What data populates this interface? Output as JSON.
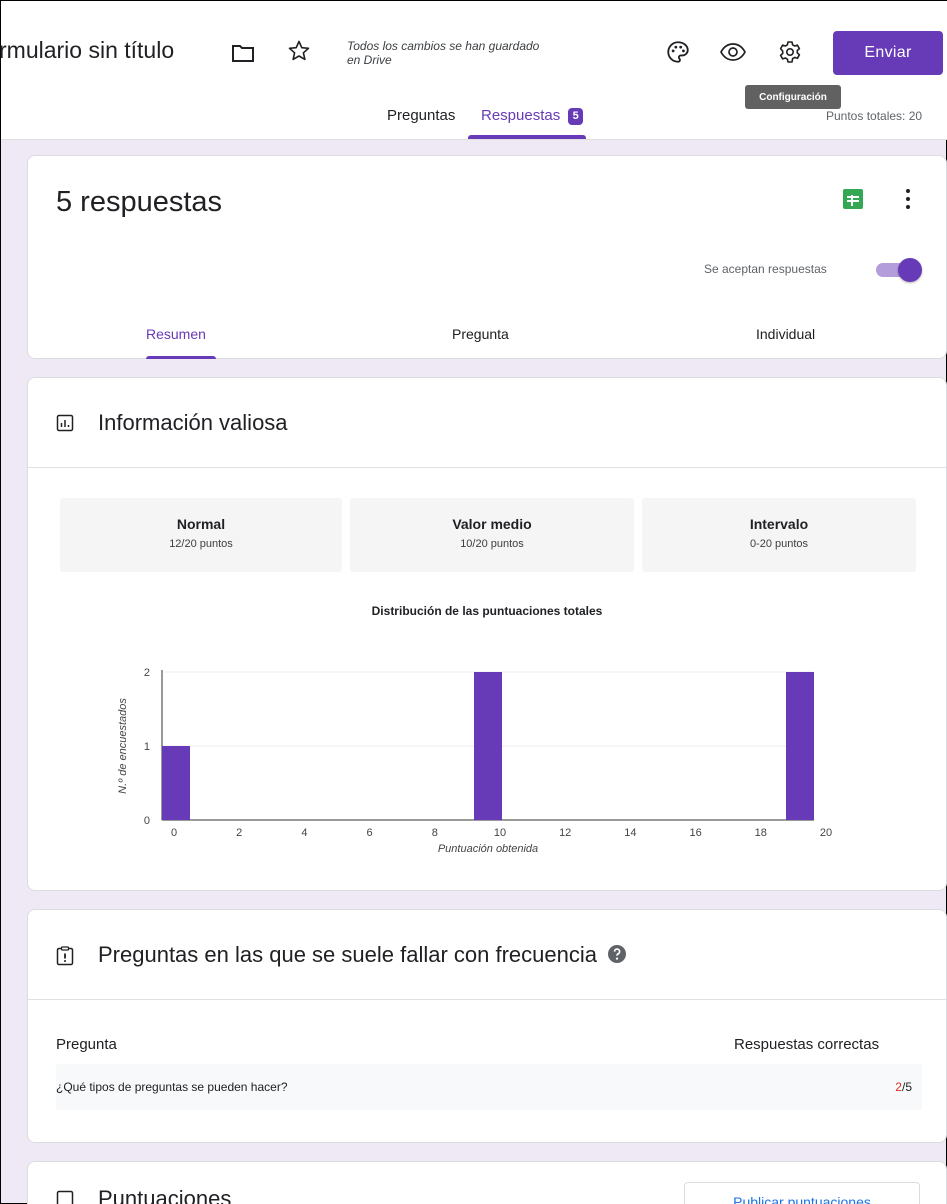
{
  "header": {
    "form_title": "rmulario sin título",
    "saved_status": "Todos los cambios se han guardado en Drive",
    "send_label": "Enviar",
    "tooltip": "Configuración",
    "tabs": [
      {
        "label": "Preguntas"
      },
      {
        "label": "Respuestas",
        "badge": "5"
      }
    ],
    "total_points": "Puntos totales: 20",
    "accent_color": "#673ab7"
  },
  "responses_card": {
    "title": "5 respuestas",
    "accepting_label": "Se aceptan respuestas",
    "accepting": true,
    "subtabs": [
      {
        "label": "Resumen"
      },
      {
        "label": "Pregunta"
      },
      {
        "label": "Individual"
      }
    ]
  },
  "insights": {
    "title": "Información valiosa",
    "stats": [
      {
        "label": "Normal",
        "value": "12/20 puntos"
      },
      {
        "label": "Valor medio",
        "value": "10/20 puntos"
      },
      {
        "label": "Intervalo",
        "value": "0-20 puntos"
      }
    ]
  },
  "chart_data": {
    "type": "bar",
    "title": "Distribución de las puntuaciones totales",
    "xlabel": "Puntuación obtenida",
    "ylabel": "N.º de encuestados",
    "x": [
      0,
      10,
      20
    ],
    "values": [
      1,
      2,
      2
    ],
    "xticks": [
      "0",
      "2",
      "4",
      "6",
      "8",
      "10",
      "12",
      "14",
      "16",
      "18",
      "20"
    ],
    "yticks": [
      "0",
      "1",
      "2"
    ],
    "xlim": [
      0,
      20
    ],
    "ylim": [
      0,
      2
    ],
    "color": "#673ab7"
  },
  "frequent_fail": {
    "title": "Preguntas en las que se suele fallar con frecuencia",
    "col_question": "Pregunta",
    "col_correct": "Respuestas correctas",
    "rows": [
      {
        "question": "¿Qué tipos de preguntas se pueden hacer?",
        "correct": "2",
        "total": "/5"
      }
    ]
  },
  "scores": {
    "title": "Puntuaciones",
    "publish_label": "Publicar puntuaciones"
  }
}
